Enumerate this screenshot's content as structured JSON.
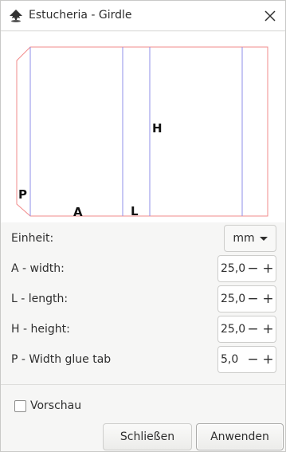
{
  "window": {
    "title": "Estucheria - Girdle",
    "app_icon": "inkscape-icon",
    "close_icon": "close-icon"
  },
  "diagram": {
    "labels": {
      "p": "P",
      "a": "A",
      "l": "L",
      "h": "H"
    },
    "colors": {
      "cut_line": "#f28b8b",
      "fold_line": "#8f8fe8"
    }
  },
  "form": {
    "unit": {
      "label": "Einheit:",
      "value": "mm"
    },
    "fields": [
      {
        "label": "A - width:",
        "value": "25,0"
      },
      {
        "label": "L - length:",
        "value": "25,0"
      },
      {
        "label": "H - height:",
        "value": "25,0"
      },
      {
        "label": "P - Width glue tab",
        "value": "5,0"
      }
    ],
    "minus": "−",
    "plus": "+"
  },
  "preview": {
    "label": "Vorschau",
    "checked": false
  },
  "buttons": {
    "close": "Schließen",
    "apply": "Anwenden"
  }
}
